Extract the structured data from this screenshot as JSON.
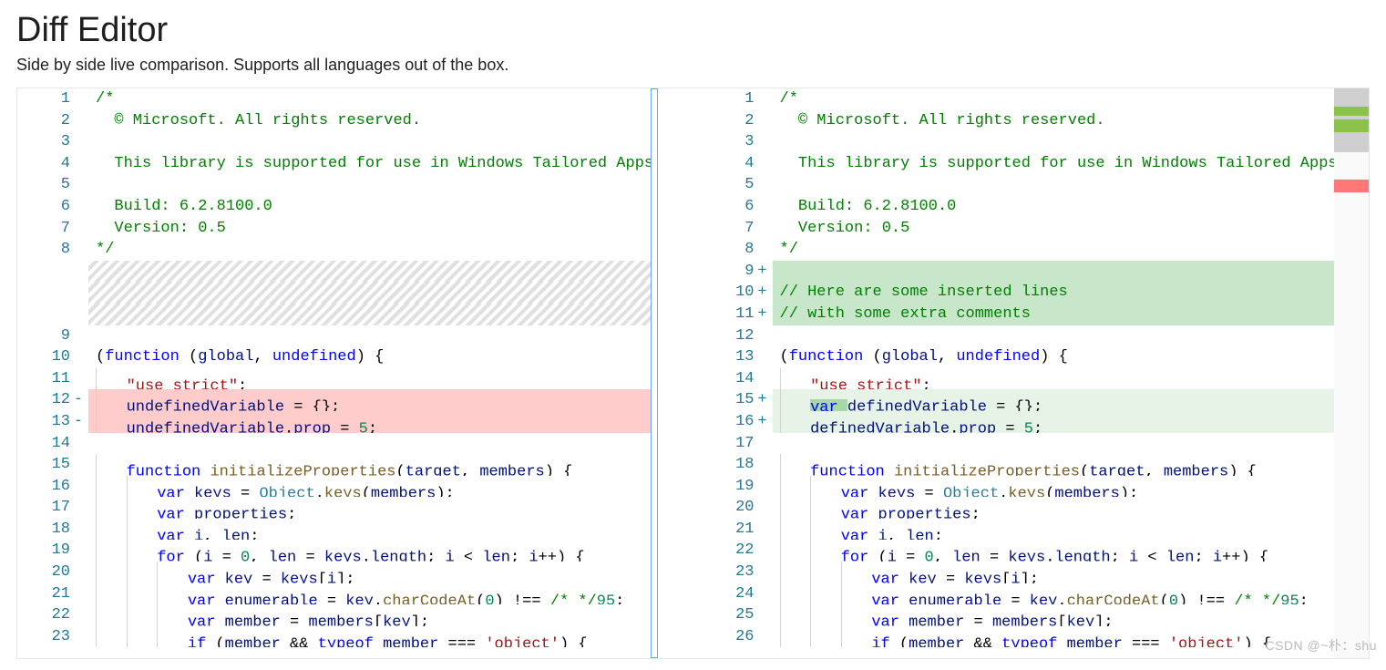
{
  "header": {
    "title": "Diff Editor",
    "subtitle": "Side by side live comparison. Supports all languages out of the box."
  },
  "watermark": "CSDN @~朴：shu",
  "diff": {
    "left": [
      {
        "n": 1,
        "t": "comment",
        "text": "/*"
      },
      {
        "n": 2,
        "t": "comment",
        "text": "  © Microsoft. All rights reserved."
      },
      {
        "n": 3,
        "t": "comment",
        "text": ""
      },
      {
        "n": 4,
        "t": "comment",
        "text": "  This library is supported for use in Windows Tailored Apps on"
      },
      {
        "n": 5,
        "t": "comment",
        "text": ""
      },
      {
        "n": 6,
        "t": "comment",
        "text": "  Build: 6.2.8100.0"
      },
      {
        "n": 7,
        "t": "comment",
        "text": "  Version: 0.5"
      },
      {
        "n": 8,
        "t": "comment",
        "text": "*/"
      },
      {
        "filler": true
      },
      {
        "filler": true
      },
      {
        "filler": true
      },
      {
        "n": 9,
        "text": ""
      },
      {
        "n": 10,
        "kind": "funcline"
      },
      {
        "n": 11,
        "kind": "usestrict"
      },
      {
        "n": 12,
        "kind": "removed1",
        "removed": true
      },
      {
        "n": 13,
        "kind": "removed2",
        "removed": true
      },
      {
        "n": 14,
        "text": ""
      },
      {
        "n": 15,
        "kind": "initFn"
      },
      {
        "n": 16,
        "kind": "keysAssign"
      },
      {
        "n": 17,
        "kind": "propsDecl"
      },
      {
        "n": 18,
        "kind": "ilenDecl"
      },
      {
        "n": 19,
        "kind": "forLoop"
      },
      {
        "n": 20,
        "kind": "keyAssign"
      },
      {
        "n": 21,
        "kind": "enumAssign"
      },
      {
        "n": 22,
        "kind": "memberAssign"
      },
      {
        "n": 23,
        "kind": "ifMember"
      }
    ],
    "right": [
      {
        "n": 1,
        "t": "comment",
        "text": "/*"
      },
      {
        "n": 2,
        "t": "comment",
        "text": "  © Microsoft. All rights reserved."
      },
      {
        "n": 3,
        "t": "comment",
        "text": ""
      },
      {
        "n": 4,
        "t": "comment",
        "text": "  This library is supported for use in Windows Tailored Apps only."
      },
      {
        "n": 5,
        "t": "comment",
        "text": ""
      },
      {
        "n": 6,
        "t": "comment",
        "text": "  Build: 6.2.8100.0"
      },
      {
        "n": 7,
        "t": "comment",
        "text": "  Version: 0.5"
      },
      {
        "n": 8,
        "t": "comment",
        "text": "*/"
      },
      {
        "n": 9,
        "added": true,
        "t": "comment",
        "text": ""
      },
      {
        "n": 10,
        "added": true,
        "t": "comment",
        "text": "// Here are some inserted lines"
      },
      {
        "n": 11,
        "added": true,
        "t": "comment",
        "text": "// with some extra comments"
      },
      {
        "n": 12,
        "text": ""
      },
      {
        "n": 13,
        "kind": "funcline"
      },
      {
        "n": 14,
        "kind": "usestrict"
      },
      {
        "n": 15,
        "kind": "added1",
        "added": true,
        "light": true
      },
      {
        "n": 16,
        "kind": "added2",
        "added": true,
        "light": true
      },
      {
        "n": 17,
        "text": ""
      },
      {
        "n": 18,
        "kind": "initFn"
      },
      {
        "n": 19,
        "kind": "keysAssign"
      },
      {
        "n": 20,
        "kind": "propsDecl"
      },
      {
        "n": 21,
        "kind": "ilenDecl"
      },
      {
        "n": 22,
        "kind": "forLoop"
      },
      {
        "n": 23,
        "kind": "keyAssign"
      },
      {
        "n": 24,
        "kind": "enumAssign"
      },
      {
        "n": 25,
        "kind": "memberAssign"
      },
      {
        "n": 26,
        "kind": "ifMember"
      }
    ]
  },
  "tokens": {
    "funcline": [
      {
        "c": "punct",
        "v": "("
      },
      {
        "c": "kw",
        "v": "function"
      },
      {
        "c": "punct",
        "v": " ("
      },
      {
        "c": "var",
        "v": "global"
      },
      {
        "c": "punct",
        "v": ", "
      },
      {
        "c": "kw",
        "v": "undefined"
      },
      {
        "c": "punct",
        "v": ") {"
      }
    ],
    "usestrict": [
      {
        "indent": 1
      },
      {
        "c": "str",
        "v": "\"use strict\""
      },
      {
        "c": "punct",
        "v": ";"
      }
    ],
    "removed1": [
      {
        "indent": 1
      },
      {
        "c": "var",
        "v": "undefinedVariable"
      },
      {
        "c": "punct",
        "v": " = {};"
      }
    ],
    "removed2": [
      {
        "indent": 1
      },
      {
        "c": "var",
        "v": "undefinedVariable"
      },
      {
        "c": "punct",
        "v": "."
      },
      {
        "c": "var",
        "v": "prop"
      },
      {
        "c": "punct",
        "v": " = "
      },
      {
        "c": "num",
        "v": "5"
      },
      {
        "c": "punct",
        "v": ";"
      }
    ],
    "added1": [
      {
        "indent": 1
      },
      {
        "hl": true,
        "c": "kw",
        "v": "var "
      },
      {
        "c": "var",
        "v": "definedVariable"
      },
      {
        "c": "punct",
        "v": " = {};"
      }
    ],
    "added2": [
      {
        "indent": 1
      },
      {
        "c": "var",
        "v": "definedVariable"
      },
      {
        "c": "punct",
        "v": "."
      },
      {
        "c": "var",
        "v": "prop"
      },
      {
        "c": "punct",
        "v": " = "
      },
      {
        "c": "num",
        "v": "5"
      },
      {
        "c": "punct",
        "v": ";"
      }
    ],
    "initFn": [
      {
        "indent": 1
      },
      {
        "c": "kw",
        "v": "function"
      },
      {
        "c": "punct",
        "v": " "
      },
      {
        "c": "fn",
        "v": "initializeProperties"
      },
      {
        "c": "punct",
        "v": "("
      },
      {
        "c": "var",
        "v": "target"
      },
      {
        "c": "punct",
        "v": ", "
      },
      {
        "c": "var",
        "v": "members"
      },
      {
        "c": "punct",
        "v": ") {"
      }
    ],
    "keysAssign": [
      {
        "indent": 2
      },
      {
        "c": "kw",
        "v": "var"
      },
      {
        "c": "punct",
        "v": " "
      },
      {
        "c": "var",
        "v": "keys"
      },
      {
        "c": "punct",
        "v": " = "
      },
      {
        "c": "type",
        "v": "Object"
      },
      {
        "c": "punct",
        "v": "."
      },
      {
        "c": "fn",
        "v": "keys"
      },
      {
        "c": "punct",
        "v": "("
      },
      {
        "c": "var",
        "v": "members"
      },
      {
        "c": "punct",
        "v": ");"
      }
    ],
    "propsDecl": [
      {
        "indent": 2
      },
      {
        "c": "kw",
        "v": "var"
      },
      {
        "c": "punct",
        "v": " "
      },
      {
        "c": "var",
        "v": "properties"
      },
      {
        "c": "punct",
        "v": ";"
      }
    ],
    "ilenDecl": [
      {
        "indent": 2
      },
      {
        "c": "kw",
        "v": "var"
      },
      {
        "c": "punct",
        "v": " "
      },
      {
        "c": "var",
        "v": "i"
      },
      {
        "c": "punct",
        "v": ", "
      },
      {
        "c": "var",
        "v": "len"
      },
      {
        "c": "punct",
        "v": ";"
      }
    ],
    "forLoop": [
      {
        "indent": 2
      },
      {
        "c": "kw",
        "v": "for"
      },
      {
        "c": "punct",
        "v": " ("
      },
      {
        "c": "var",
        "v": "i"
      },
      {
        "c": "punct",
        "v": " = "
      },
      {
        "c": "num",
        "v": "0"
      },
      {
        "c": "punct",
        "v": ", "
      },
      {
        "c": "var",
        "v": "len"
      },
      {
        "c": "punct",
        "v": " = "
      },
      {
        "c": "var",
        "v": "keys"
      },
      {
        "c": "punct",
        "v": "."
      },
      {
        "c": "var",
        "v": "length"
      },
      {
        "c": "punct",
        "v": "; "
      },
      {
        "c": "var",
        "v": "i"
      },
      {
        "c": "punct",
        "v": " < "
      },
      {
        "c": "var",
        "v": "len"
      },
      {
        "c": "punct",
        "v": "; "
      },
      {
        "c": "var",
        "v": "i"
      },
      {
        "c": "punct",
        "v": "++) {"
      }
    ],
    "keyAssign": [
      {
        "indent": 3
      },
      {
        "c": "kw",
        "v": "var"
      },
      {
        "c": "punct",
        "v": " "
      },
      {
        "c": "var",
        "v": "key"
      },
      {
        "c": "punct",
        "v": " = "
      },
      {
        "c": "var",
        "v": "keys"
      },
      {
        "c": "punct",
        "v": "["
      },
      {
        "c": "var",
        "v": "i"
      },
      {
        "c": "punct",
        "v": "];"
      }
    ],
    "enumAssign": [
      {
        "indent": 3
      },
      {
        "c": "kw",
        "v": "var"
      },
      {
        "c": "punct",
        "v": " "
      },
      {
        "c": "var",
        "v": "enumerable"
      },
      {
        "c": "punct",
        "v": " = "
      },
      {
        "c": "var",
        "v": "key"
      },
      {
        "c": "punct",
        "v": "."
      },
      {
        "c": "fn",
        "v": "charCodeAt"
      },
      {
        "c": "punct",
        "v": "("
      },
      {
        "c": "num",
        "v": "0"
      },
      {
        "c": "punct",
        "v": ") !== "
      },
      {
        "c": "comment",
        "v": "/*_*/"
      },
      {
        "c": "num",
        "v": "95"
      },
      {
        "c": "punct",
        "v": ";"
      }
    ],
    "memberAssign": [
      {
        "indent": 3
      },
      {
        "c": "kw",
        "v": "var"
      },
      {
        "c": "punct",
        "v": " "
      },
      {
        "c": "var",
        "v": "member"
      },
      {
        "c": "punct",
        "v": " = "
      },
      {
        "c": "var",
        "v": "members"
      },
      {
        "c": "punct",
        "v": "["
      },
      {
        "c": "var",
        "v": "key"
      },
      {
        "c": "punct",
        "v": "];"
      }
    ],
    "ifMember": [
      {
        "indent": 3
      },
      {
        "c": "kw",
        "v": "if"
      },
      {
        "c": "punct",
        "v": " ("
      },
      {
        "c": "var",
        "v": "member"
      },
      {
        "c": "punct",
        "v": " && "
      },
      {
        "c": "kw",
        "v": "typeof"
      },
      {
        "c": "punct",
        "v": " "
      },
      {
        "c": "var",
        "v": "member"
      },
      {
        "c": "punct",
        "v": " === "
      },
      {
        "c": "str",
        "v": "'object'"
      },
      {
        "c": "punct",
        "v": ") {"
      }
    ]
  }
}
